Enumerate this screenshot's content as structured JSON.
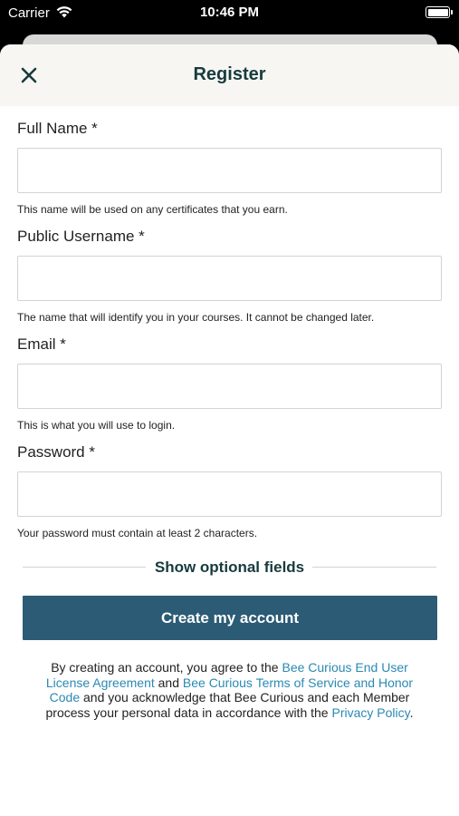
{
  "status_bar": {
    "carrier": "Carrier",
    "time": "10:46 PM"
  },
  "header": {
    "title": "Register"
  },
  "fields": [
    {
      "label": "Full Name *",
      "value": "",
      "hint": "This name will be used on any certificates that you earn."
    },
    {
      "label": "Public Username *",
      "value": "",
      "hint": "The name that will identify you in your courses. It cannot be changed later."
    },
    {
      "label": "Email *",
      "value": "",
      "hint": "This is what you will use to login."
    },
    {
      "label": "Password *",
      "value": "",
      "hint": "Your password must contain at least 2 characters."
    }
  ],
  "optional_fields_label": "Show optional fields",
  "create_account_label": "Create my account",
  "legal": {
    "part1": "By creating an account, you agree to the ",
    "eula_link": "Bee Curious End User License Agreement",
    "part2": " and ",
    "tos_link": "Bee Curious Terms of Service and Honor Code",
    "part3": " and you acknowledge that Bee Curious and each Member process your personal data in accordance with the ",
    "privacy_link": "Privacy Policy",
    "part4": "."
  },
  "colors": {
    "accent": "#2c5b75",
    "title": "#173b3d",
    "link": "#2a89b3",
    "header_bg": "#f7f6f3"
  },
  "icons": {
    "close": "close-icon",
    "wifi": "wifi-icon",
    "battery": "battery-icon"
  }
}
